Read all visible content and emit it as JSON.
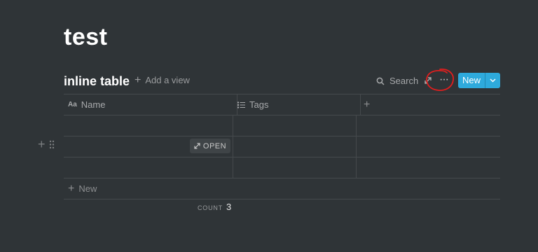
{
  "page": {
    "title": "test"
  },
  "database": {
    "title": "inline table",
    "add_view_label": "Add a view",
    "search_label": "Search",
    "more_label": "···",
    "new_label": "New",
    "columns": [
      {
        "label": "Name",
        "icon": "text-property-icon",
        "icon_text": "Aa"
      },
      {
        "label": "Tags",
        "icon": "list-property-icon"
      },
      {
        "label": "+",
        "icon": "add-property-icon"
      }
    ],
    "rows": [
      {
        "name": "",
        "tags": ""
      },
      {
        "name": "",
        "tags": "",
        "hovered": true
      },
      {
        "name": "",
        "tags": ""
      }
    ],
    "open_label": "OPEN",
    "new_row_label": "New",
    "count_label": "COUNT",
    "count_value": "3"
  },
  "colors": {
    "background": "#2f3437",
    "accent": "#2eaadc",
    "annotation": "#e01e1e"
  }
}
